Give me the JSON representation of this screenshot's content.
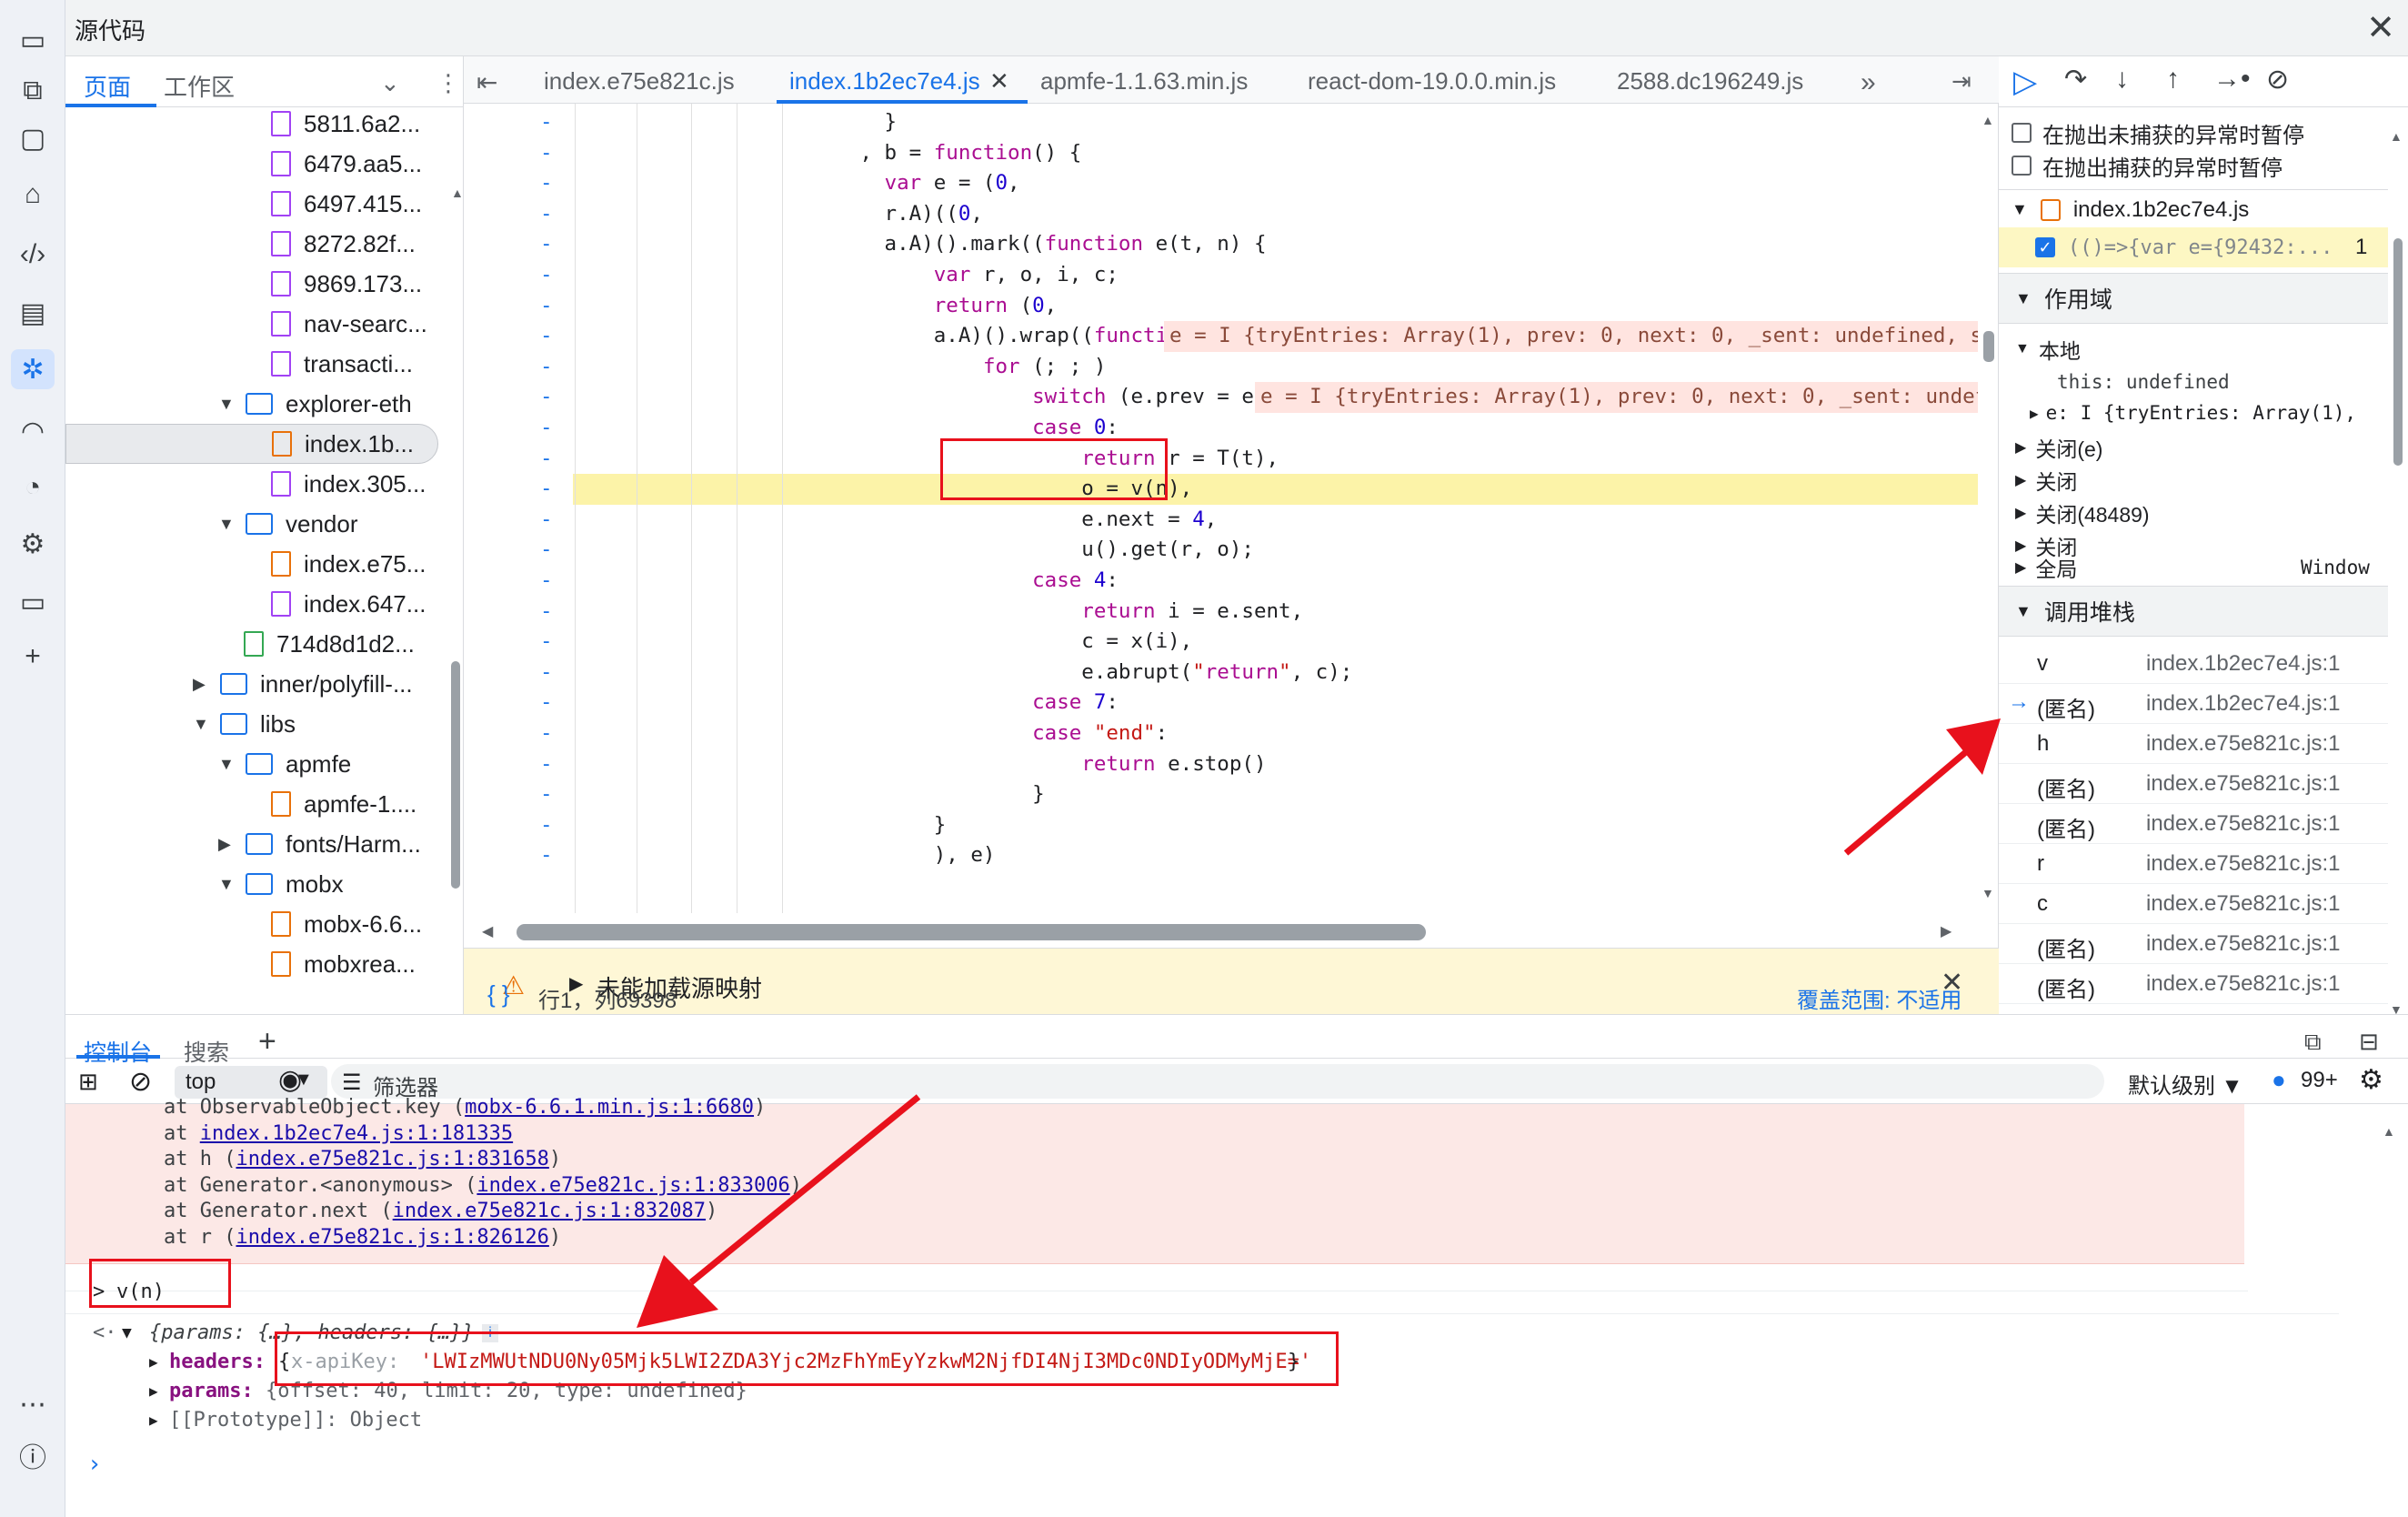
{
  "window": {
    "title": "源代码",
    "close": "✕"
  },
  "navigator": {
    "tabs": [
      "页面",
      "工作区"
    ],
    "items": [
      {
        "label": "5811.6a2...",
        "type": "file",
        "color": "purple"
      },
      {
        "label": "6479.aa5...",
        "type": "file",
        "color": "purple"
      },
      {
        "label": "6497.415...",
        "type": "file",
        "color": "purple"
      },
      {
        "label": "8272.82f...",
        "type": "file",
        "color": "purple"
      },
      {
        "label": "9869.173...",
        "type": "file",
        "color": "purple"
      },
      {
        "label": "nav-searc...",
        "type": "file",
        "color": "purple"
      },
      {
        "label": "transacti...",
        "type": "file",
        "color": "purple"
      },
      {
        "label": "explorer-eth",
        "type": "folder",
        "open": true
      },
      {
        "label": "index.1b...",
        "type": "file",
        "color": "orange",
        "selected": true
      },
      {
        "label": "index.305...",
        "type": "file",
        "color": "purple"
      },
      {
        "label": "vendor",
        "type": "folder",
        "open": true
      },
      {
        "label": "index.e75...",
        "type": "file",
        "color": "orange"
      },
      {
        "label": "index.647...",
        "type": "file",
        "color": "purple"
      },
      {
        "label": "714d8d1d2...",
        "type": "file",
        "color": "green"
      },
      {
        "label": "inner/polyfill-...",
        "type": "folder",
        "open": false
      },
      {
        "label": "libs",
        "type": "folder",
        "open": true
      },
      {
        "label": "apmfe",
        "type": "folder",
        "open": true
      },
      {
        "label": "apmfe-1....",
        "type": "file",
        "color": "orange"
      },
      {
        "label": "fonts/Harm...",
        "type": "folder",
        "open": false
      },
      {
        "label": "mobx",
        "type": "folder",
        "open": true
      },
      {
        "label": "mobx-6.6...",
        "type": "file",
        "color": "orange"
      },
      {
        "label": "mobxrea...",
        "type": "file",
        "color": "orange"
      }
    ]
  },
  "editor": {
    "tabs": [
      "index.e75e821c.js",
      "index.1b2ec7e4.js",
      "apmfe-1.1.63.min.js",
      "react-dom-19.0.0.min.js",
      "2588.dc196249.js"
    ],
    "lines": [
      "            }",
      "          , b = function() {",
      "            var e = (0,",
      "            r.A)((0,",
      "            a.A)().mark((function e(t, n) {",
      "                var r, o, i, c;",
      "                return (0,",
      "                a.A)().wrap((function(e) {",
      "                    for (; ; )",
      "                        switch (e.prev = e.next) {",
      "                        case 0:",
      "                            return r = T(t),",
      "                            o = v(n),",
      "                            e.next = 4,",
      "                            u().get(r, o);",
      "                        case 4:",
      "                            return i = e.sent,",
      "                            c = x(i),",
      "                            e.abrupt(\"return\", c);",
      "                        case 7:",
      "                        case \"end\":",
      "                            return e.stop()",
      "                        }",
      "                }",
      "                ), e)"
    ],
    "inline_badge_1": "e = I {tryEntries: Array(1), prev: 0, next: 0, _sent: undefined, se",
    "inline_badge_2": "e = I {tryEntries: Array(1), prev: 0, next: 0, _sent: undef",
    "sourcemap_warning": "未能加载源映射",
    "status_braces": "{ }",
    "status_position": "行1，列69398",
    "coverage": "覆盖范围: 不适用"
  },
  "debugger": {
    "pause_uncaught": "在抛出未捕获的异常时暂停",
    "pause_caught": "在抛出捕获的异常时暂停",
    "breakpoint_file": "index.1b2ec7e4.js",
    "breakpoint_code": "(()=>{var e={92432:...",
    "breakpoint_line": "1",
    "scope_title": "作用域",
    "scope_local": "本地",
    "scope_this": "this: undefined",
    "scope_e": "e: I {tryEntries: Array(1),",
    "closures": [
      "关闭(e)",
      "关闭",
      "关闭(48489)",
      "关闭"
    ],
    "global": "全局",
    "global_value": "Window",
    "callstack_title": "调用堆栈",
    "callstack": [
      {
        "fn": "v",
        "loc": "index.1b2ec7e4.js:1"
      },
      {
        "fn": "(匿名)",
        "loc": "index.1b2ec7e4.js:1",
        "current": true
      },
      {
        "fn": "h",
        "loc": "index.e75e821c.js:1"
      },
      {
        "fn": "(匿名)",
        "loc": "index.e75e821c.js:1"
      },
      {
        "fn": "(匿名)",
        "loc": "index.e75e821c.js:1"
      },
      {
        "fn": "r",
        "loc": "index.e75e821c.js:1"
      },
      {
        "fn": "c",
        "loc": "index.e75e821c.js:1"
      },
      {
        "fn": "(匿名)",
        "loc": "index.e75e821c.js:1"
      },
      {
        "fn": "(匿名)",
        "loc": "index.e75e821c.js:1"
      }
    ]
  },
  "drawer": {
    "tabs": [
      "控制台",
      "搜索"
    ],
    "context": "top",
    "filter_placeholder": "筛选器",
    "levels": "默认级别",
    "issues_count": "99+",
    "error_lines": [
      {
        "prefix": "at ObservableObject.key (",
        "link": "mobx-6.6.1.min.js:1:6680",
        "suffix": ")"
      },
      {
        "prefix": "at ",
        "link": "index.1b2ec7e4.js:1:181335",
        "suffix": ""
      },
      {
        "prefix": "at h (",
        "link": "index.e75e821c.js:1:831658",
        "suffix": ")"
      },
      {
        "prefix": "at Generator.<anonymous> (",
        "link": "index.e75e821c.js:1:833006",
        "suffix": ")"
      },
      {
        "prefix": "at Generator.next (",
        "link": "index.e75e821c.js:1:832087",
        "suffix": ")"
      },
      {
        "prefix": "at r (",
        "link": "index.e75e821c.js:1:826126",
        "suffix": ")"
      }
    ],
    "input_cmd": "v(n)",
    "result_summary": "{params: {…}, headers: {…}}",
    "headers_key": "headers:",
    "headers_val_key": "x-apiKey:",
    "headers_val": "'LWIzMWUtNDU0Ny05Mjk5LWI2ZDA3Yjc2MzFhYmEyYzkwM2NjfDI4NjI3MDc0NDIyODMyMjE='",
    "params_key": "params:",
    "params_val": "{offset: 40, limit: 20, type: undefined}",
    "proto": "[[Prototype]]: Object"
  }
}
